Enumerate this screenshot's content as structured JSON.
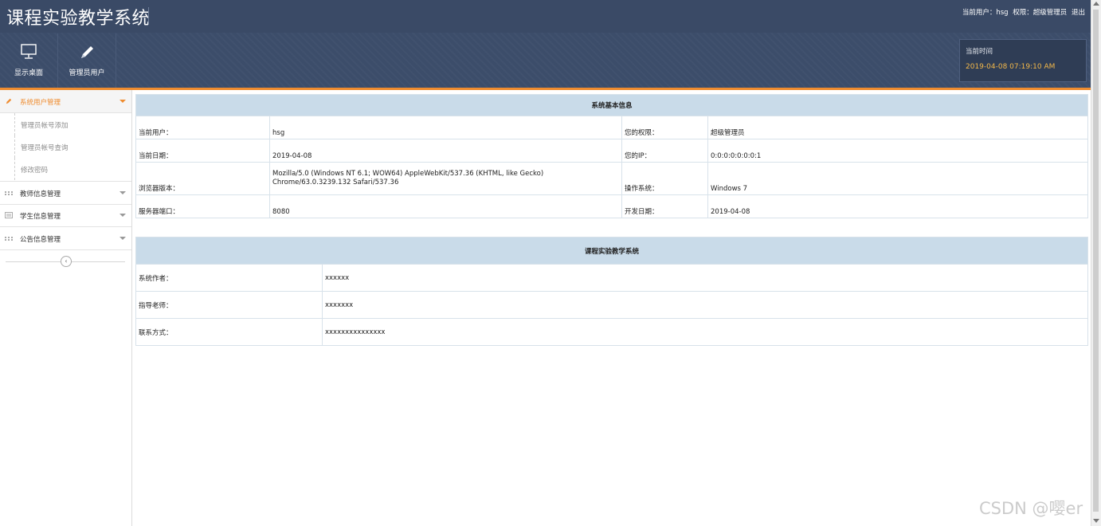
{
  "header": {
    "app_title": "课程实验教学系统",
    "current_user_label": "当前用户：",
    "current_user": "hsg",
    "permission_label": "权限：",
    "permission": "超级管理员",
    "logout": "退出",
    "time_label": "当前时间",
    "time_value": "2019-04-08 07:19:10 AM"
  },
  "toolbar": {
    "items": [
      {
        "label": "显示桌面",
        "icon": "monitor-icon"
      },
      {
        "label": "管理员用户",
        "icon": "pencil-icon"
      }
    ]
  },
  "sidebar": {
    "groups": [
      {
        "label": "系统用户管理",
        "icon": "pencil-icon",
        "active": true,
        "items": [
          {
            "label": "管理员帐号添加"
          },
          {
            "label": "管理员帐号查询"
          },
          {
            "label": "修改密码"
          }
        ]
      },
      {
        "label": "教师信息管理",
        "icon": "grid-icon"
      },
      {
        "label": "学生信息管理",
        "icon": "card-icon"
      },
      {
        "label": "公告信息管理",
        "icon": "grid-icon"
      }
    ]
  },
  "sys_info": {
    "title": "系统基本信息",
    "rows": [
      {
        "k1": "当前用户：",
        "v1": "hsg",
        "k2": "您的权限：",
        "v2": "超级管理员"
      },
      {
        "k1": "当前日期：",
        "v1": "2019-04-08",
        "k2": "您的IP：",
        "v2": "0:0:0:0:0:0:0:1"
      },
      {
        "k1": "浏览器版本：",
        "v1": "Mozilla/5.0 (Windows NT 6.1; WOW64) AppleWebKit/537.36 (KHTML, like Gecko) Chrome/63.0.3239.132 Safari/537.36",
        "k2": "操作系统：",
        "v2": "Windows 7"
      },
      {
        "k1": "服务器端口：",
        "v1": "8080",
        "k2": "开发日期：",
        "v2": "2019-04-08"
      }
    ]
  },
  "about": {
    "title": "课程实验教学系统",
    "rows": [
      {
        "k": "系统作者：",
        "v": "xxxxxx"
      },
      {
        "k": "指导老师：",
        "v": "xxxxxxx"
      },
      {
        "k": "联系方式：",
        "v": "xxxxxxxxxxxxxxx"
      }
    ]
  },
  "watermark": "CSDN @嘤er",
  "colors": {
    "header_bg": "#3c4d6a",
    "accent": "#ef8c2f",
    "time_value": "#f3b84a",
    "table_head": "#c9dbe9"
  }
}
